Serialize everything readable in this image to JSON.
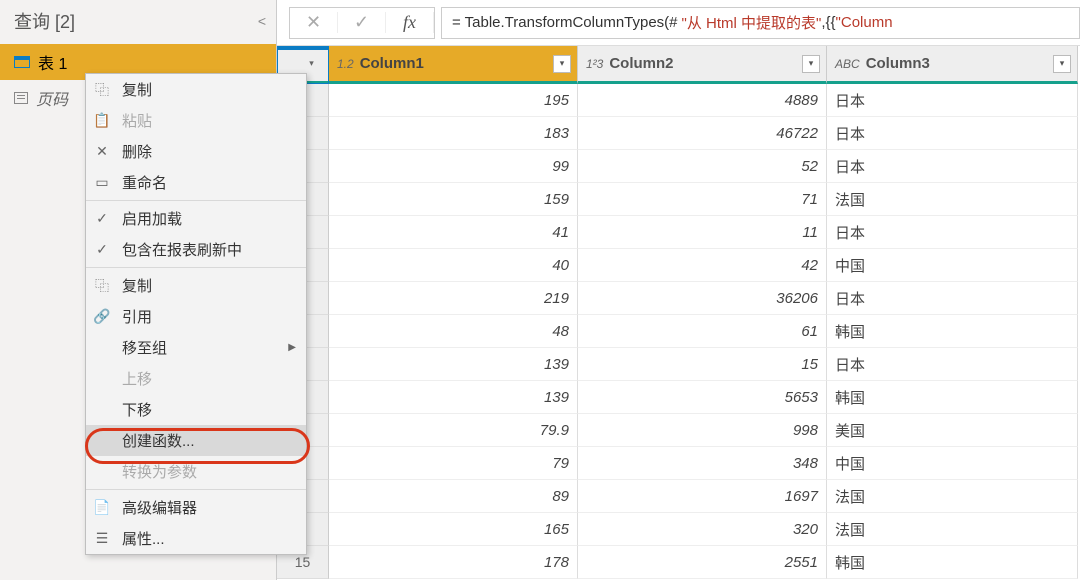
{
  "sidebar": {
    "title": "查询 [2]",
    "items": [
      {
        "label": "表 1"
      },
      {
        "label": "页码"
      }
    ]
  },
  "formula": {
    "prefix": "= Table.TransformColumnTypes(#",
    "str1": "\"从 Html 中提取的表\"",
    "mid": ",{{",
    "str2": "\"Column"
  },
  "columns": [
    {
      "type": "1.2",
      "name": "Column1"
    },
    {
      "type": "1²3",
      "name": "Column2"
    },
    {
      "type": "ABC",
      "name": "Column3"
    }
  ],
  "rows": [
    {
      "n": "",
      "c1": "195",
      "c2": "4889",
      "c3": "日本"
    },
    {
      "n": "",
      "c1": "183",
      "c2": "46722",
      "c3": "日本"
    },
    {
      "n": "",
      "c1": "99",
      "c2": "52",
      "c3": "日本"
    },
    {
      "n": "",
      "c1": "159",
      "c2": "71",
      "c3": "法国"
    },
    {
      "n": "",
      "c1": "41",
      "c2": "11",
      "c3": "日本"
    },
    {
      "n": "",
      "c1": "40",
      "c2": "42",
      "c3": "中国"
    },
    {
      "n": "",
      "c1": "219",
      "c2": "36206",
      "c3": "日本"
    },
    {
      "n": "",
      "c1": "48",
      "c2": "61",
      "c3": "韩国"
    },
    {
      "n": "",
      "c1": "139",
      "c2": "15",
      "c3": "日本"
    },
    {
      "n": "",
      "c1": "139",
      "c2": "5653",
      "c3": "韩国"
    },
    {
      "n": "",
      "c1": "79.9",
      "c2": "998",
      "c3": "美国"
    },
    {
      "n": "",
      "c1": "79",
      "c2": "348",
      "c3": "中国"
    },
    {
      "n": "",
      "c1": "89",
      "c2": "1697",
      "c3": "法国"
    },
    {
      "n": "",
      "c1": "165",
      "c2": "320",
      "c3": "法国"
    },
    {
      "n": "15",
      "c1": "178",
      "c2": "2551",
      "c3": "韩国"
    }
  ],
  "menu": {
    "copy": "复制",
    "paste": "粘贴",
    "delete": "删除",
    "rename": "重命名",
    "enable_load": "启用加载",
    "include_refresh": "包含在报表刷新中",
    "copy2": "复制",
    "reference": "引用",
    "move_group": "移至组",
    "move_up": "上移",
    "move_down": "下移",
    "create_func": "创建函数...",
    "to_param": "转换为参数",
    "adv_editor": "高级编辑器",
    "properties": "属性..."
  }
}
